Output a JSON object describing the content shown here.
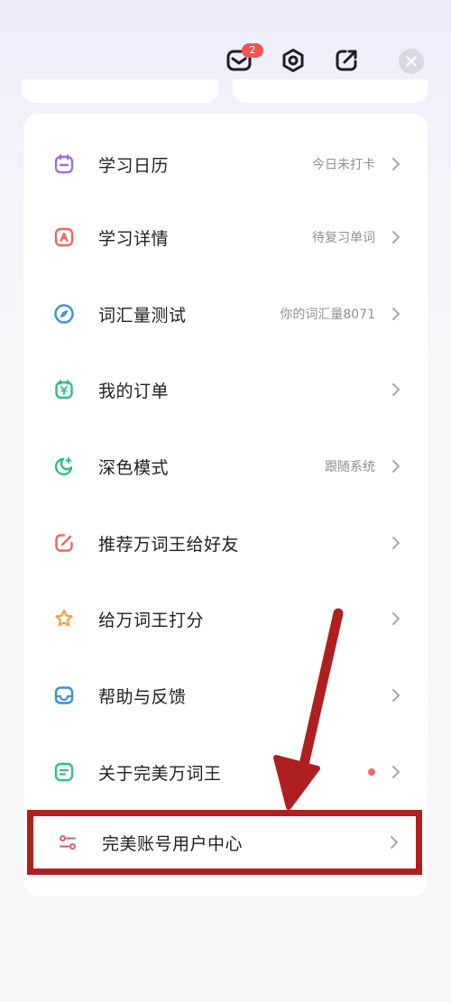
{
  "header": {
    "mail_badge": "2",
    "icons": [
      "mail-icon",
      "settings-icon",
      "share-icon",
      "close-icon"
    ]
  },
  "menu": {
    "items": [
      {
        "label": "学习日历",
        "value": "今日未打卡",
        "icon": "calendar-icon",
        "color": "#9b6ee6"
      },
      {
        "label": "学习详情",
        "value": "待复习单词",
        "icon": "study-detail-icon",
        "color": "#ef6464"
      },
      {
        "label": "词汇量测试",
        "value": "你的词汇量8071",
        "icon": "compass-icon",
        "color": "#3a8fe0"
      },
      {
        "label": "我的订单",
        "value": "",
        "icon": "order-icon",
        "color": "#2fbf88"
      },
      {
        "label": "深色模式",
        "value": "跟随系统",
        "icon": "moon-icon",
        "color": "#2fbf88"
      },
      {
        "label": "推荐万词王给好友",
        "value": "",
        "icon": "recommend-icon",
        "color": "#ef6464"
      },
      {
        "label": "给万词王打分",
        "value": "",
        "icon": "star-icon",
        "color": "#f4a236"
      },
      {
        "label": "帮助与反馈",
        "value": "",
        "icon": "help-icon",
        "color": "#3a8fe0"
      },
      {
        "label": "关于完美万词王",
        "value": "",
        "icon": "about-icon",
        "color": "#2fbf88",
        "dot": true
      },
      {
        "label": "完美账号用户中心",
        "value": "",
        "icon": "user-center-icon",
        "color": "#e05a7a"
      }
    ]
  },
  "colors": {
    "annotation_red": "#b01f1f",
    "text_primary": "#1e1e24",
    "text_secondary": "#8e8e96"
  }
}
